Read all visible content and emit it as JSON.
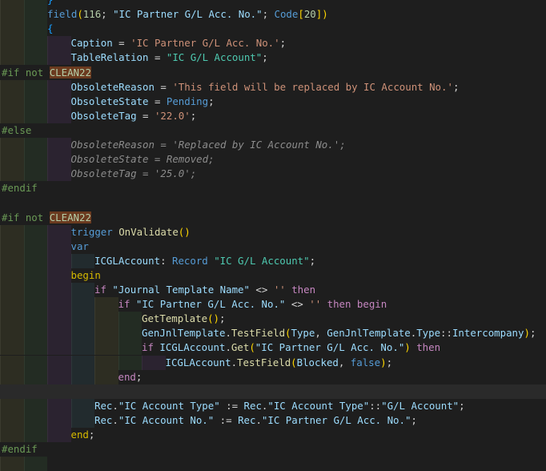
{
  "editor": {
    "language": "AL",
    "lines": [
      {
        "indent": 2,
        "tokens": [
          {
            "t": "}",
            "c": "br3"
          }
        ]
      },
      {
        "indent": 2,
        "tokens": [
          {
            "t": "field",
            "c": "kw"
          },
          {
            "t": "(",
            "c": "br1"
          },
          {
            "t": "116",
            "c": "num"
          },
          {
            "t": "; ",
            "c": "pun"
          },
          {
            "t": "\"IC Partner G/L Acc. No.\"",
            "c": "qid"
          },
          {
            "t": "; ",
            "c": "pun"
          },
          {
            "t": "Code",
            "c": "kw"
          },
          {
            "t": "[",
            "c": "br1"
          },
          {
            "t": "20",
            "c": "num"
          },
          {
            "t": "]",
            "c": "br1"
          },
          {
            "t": ")",
            "c": "br1"
          }
        ]
      },
      {
        "indent": 2,
        "tokens": [
          {
            "t": "{",
            "c": "br3"
          }
        ]
      },
      {
        "indent": 3,
        "tokens": [
          {
            "t": "Caption",
            "c": "var"
          },
          {
            "t": " = ",
            "c": "pun"
          },
          {
            "t": "'IC Partner G/L Acc. No.'",
            "c": "str"
          },
          {
            "t": ";",
            "c": "pun"
          }
        ]
      },
      {
        "indent": 3,
        "tokens": [
          {
            "t": "TableRelation",
            "c": "var"
          },
          {
            "t": " = ",
            "c": "pun"
          },
          {
            "t": "\"IC G/L Account\"",
            "c": "tbl"
          },
          {
            "t": ";",
            "c": "pun"
          }
        ]
      },
      {
        "indent": 0,
        "pp": true,
        "tokens": [
          {
            "t": "#if not ",
            "c": "pp"
          },
          {
            "t": "CLEAN22",
            "c": "ppsym"
          }
        ]
      },
      {
        "indent": 3,
        "tokens": [
          {
            "t": "ObsoleteReason",
            "c": "var"
          },
          {
            "t": " = ",
            "c": "pun"
          },
          {
            "t": "'This field will be replaced by IC Account No.'",
            "c": "str"
          },
          {
            "t": ";",
            "c": "pun"
          }
        ]
      },
      {
        "indent": 3,
        "tokens": [
          {
            "t": "ObsoleteState",
            "c": "var"
          },
          {
            "t": " = ",
            "c": "pun"
          },
          {
            "t": "Pending",
            "c": "kw"
          },
          {
            "t": ";",
            "c": "pun"
          }
        ]
      },
      {
        "indent": 3,
        "tokens": [
          {
            "t": "ObsoleteTag",
            "c": "var"
          },
          {
            "t": " = ",
            "c": "pun"
          },
          {
            "t": "'22.0'",
            "c": "str"
          },
          {
            "t": ";",
            "c": "pun"
          }
        ]
      },
      {
        "indent": 0,
        "pp": true,
        "tokens": [
          {
            "t": "#else",
            "c": "pp"
          }
        ]
      },
      {
        "indent": 3,
        "tokens": [
          {
            "t": "ObsoleteReason = 'Replaced by IC Account No.';",
            "c": "dim"
          }
        ]
      },
      {
        "indent": 3,
        "tokens": [
          {
            "t": "ObsoleteState = Removed;",
            "c": "dim"
          }
        ]
      },
      {
        "indent": 3,
        "tokens": [
          {
            "t": "ObsoleteTag = '25.0';",
            "c": "dim"
          }
        ]
      },
      {
        "indent": 0,
        "pp": true,
        "tokens": [
          {
            "t": "#endif",
            "c": "pp"
          }
        ]
      },
      {
        "indent": 0,
        "tokens": []
      },
      {
        "indent": 0,
        "pp": true,
        "tokens": [
          {
            "t": "#if not ",
            "c": "pp"
          },
          {
            "t": "CLEAN22",
            "c": "ppsym"
          }
        ]
      },
      {
        "indent": 3,
        "tokens": [
          {
            "t": "trigger",
            "c": "kw"
          },
          {
            "t": " ",
            "c": "pun"
          },
          {
            "t": "OnValidate",
            "c": "fn"
          },
          {
            "t": "()",
            "c": "br1"
          }
        ]
      },
      {
        "indent": 3,
        "tokens": [
          {
            "t": "var",
            "c": "kw"
          }
        ]
      },
      {
        "indent": 4,
        "tokens": [
          {
            "t": "ICGLAccount",
            "c": "var"
          },
          {
            "t": ": ",
            "c": "pun"
          },
          {
            "t": "Record",
            "c": "kw"
          },
          {
            "t": " ",
            "c": "pun"
          },
          {
            "t": "\"IC G/L Account\"",
            "c": "tbl"
          },
          {
            "t": ";",
            "c": "pun"
          }
        ]
      },
      {
        "indent": 3,
        "tokens": [
          {
            "t": "begin",
            "c": "beg"
          }
        ]
      },
      {
        "indent": 4,
        "tokens": [
          {
            "t": "if",
            "c": "ctl"
          },
          {
            "t": " ",
            "c": "pun"
          },
          {
            "t": "\"Journal Template Name\"",
            "c": "qid"
          },
          {
            "t": " <> ",
            "c": "pun"
          },
          {
            "t": "''",
            "c": "str"
          },
          {
            "t": " ",
            "c": "pun"
          },
          {
            "t": "then",
            "c": "ctl"
          }
        ]
      },
      {
        "indent": 5,
        "tokens": [
          {
            "t": "if",
            "c": "ctl"
          },
          {
            "t": " ",
            "c": "pun"
          },
          {
            "t": "\"IC Partner G/L Acc. No.\"",
            "c": "qid"
          },
          {
            "t": " <> ",
            "c": "pun"
          },
          {
            "t": "''",
            "c": "str"
          },
          {
            "t": " ",
            "c": "pun"
          },
          {
            "t": "then begin",
            "c": "ctl"
          }
        ]
      },
      {
        "indent": 6,
        "tokens": [
          {
            "t": "GetTemplate",
            "c": "fn"
          },
          {
            "t": "()",
            "c": "br1"
          },
          {
            "t": ";",
            "c": "pun"
          }
        ]
      },
      {
        "indent": 6,
        "tokens": [
          {
            "t": "GenJnlTemplate",
            "c": "var"
          },
          {
            "t": ".",
            "c": "pun"
          },
          {
            "t": "TestField",
            "c": "fn"
          },
          {
            "t": "(",
            "c": "br1"
          },
          {
            "t": "Type",
            "c": "var"
          },
          {
            "t": ", ",
            "c": "pun"
          },
          {
            "t": "GenJnlTemplate",
            "c": "var"
          },
          {
            "t": ".",
            "c": "pun"
          },
          {
            "t": "Type",
            "c": "var"
          },
          {
            "t": "::",
            "c": "pun"
          },
          {
            "t": "Intercompany",
            "c": "var"
          },
          {
            "t": ")",
            "c": "br1"
          },
          {
            "t": ";",
            "c": "pun"
          }
        ]
      },
      {
        "indent": 6,
        "tokens": [
          {
            "t": "if",
            "c": "ctl"
          },
          {
            "t": " ",
            "c": "pun"
          },
          {
            "t": "ICGLAccount",
            "c": "var"
          },
          {
            "t": ".",
            "c": "pun"
          },
          {
            "t": "Get",
            "c": "fn"
          },
          {
            "t": "(",
            "c": "br1"
          },
          {
            "t": "\"IC Partner G/L Acc. No.\"",
            "c": "qid"
          },
          {
            "t": ")",
            "c": "br1"
          },
          {
            "t": " ",
            "c": "pun"
          },
          {
            "t": "then",
            "c": "ctl"
          }
        ]
      },
      {
        "indent": 7,
        "tokens": [
          {
            "t": "ICGLAccount",
            "c": "var"
          },
          {
            "t": ".",
            "c": "pun"
          },
          {
            "t": "TestField",
            "c": "fn"
          },
          {
            "t": "(",
            "c": "br1"
          },
          {
            "t": "Blocked",
            "c": "var"
          },
          {
            "t": ", ",
            "c": "pun"
          },
          {
            "t": "false",
            "c": "kw"
          },
          {
            "t": ")",
            "c": "br1"
          },
          {
            "t": ";",
            "c": "pun"
          }
        ]
      },
      {
        "indent": 5,
        "tokens": [
          {
            "t": "end",
            "c": "ctl"
          },
          {
            "t": ";",
            "c": "pun"
          }
        ]
      },
      {
        "indent": 0,
        "blank_hl": true,
        "tokens": []
      },
      {
        "indent": 4,
        "tokens": [
          {
            "t": "Rec",
            "c": "var"
          },
          {
            "t": ".",
            "c": "pun"
          },
          {
            "t": "\"IC Account Type\"",
            "c": "qid"
          },
          {
            "t": " := ",
            "c": "pun"
          },
          {
            "t": "Rec",
            "c": "var"
          },
          {
            "t": ".",
            "c": "pun"
          },
          {
            "t": "\"IC Account Type\"",
            "c": "qid"
          },
          {
            "t": "::",
            "c": "pun"
          },
          {
            "t": "\"G/L Account\"",
            "c": "qid"
          },
          {
            "t": ";",
            "c": "pun"
          }
        ]
      },
      {
        "indent": 4,
        "tokens": [
          {
            "t": "Rec",
            "c": "var"
          },
          {
            "t": ".",
            "c": "pun"
          },
          {
            "t": "\"IC Account No.\"",
            "c": "qid"
          },
          {
            "t": " := ",
            "c": "pun"
          },
          {
            "t": "Rec",
            "c": "var"
          },
          {
            "t": ".",
            "c": "pun"
          },
          {
            "t": "\"IC Partner G/L Acc. No.\"",
            "c": "qid"
          },
          {
            "t": ";",
            "c": "pun"
          }
        ]
      },
      {
        "indent": 3,
        "tokens": [
          {
            "t": "end",
            "c": "beg"
          },
          {
            "t": ";",
            "c": "pun"
          }
        ]
      },
      {
        "indent": 0,
        "pp": true,
        "tokens": [
          {
            "t": "#endif",
            "c": "pp"
          }
        ]
      },
      {
        "indent": 2,
        "tokens": []
      }
    ]
  }
}
